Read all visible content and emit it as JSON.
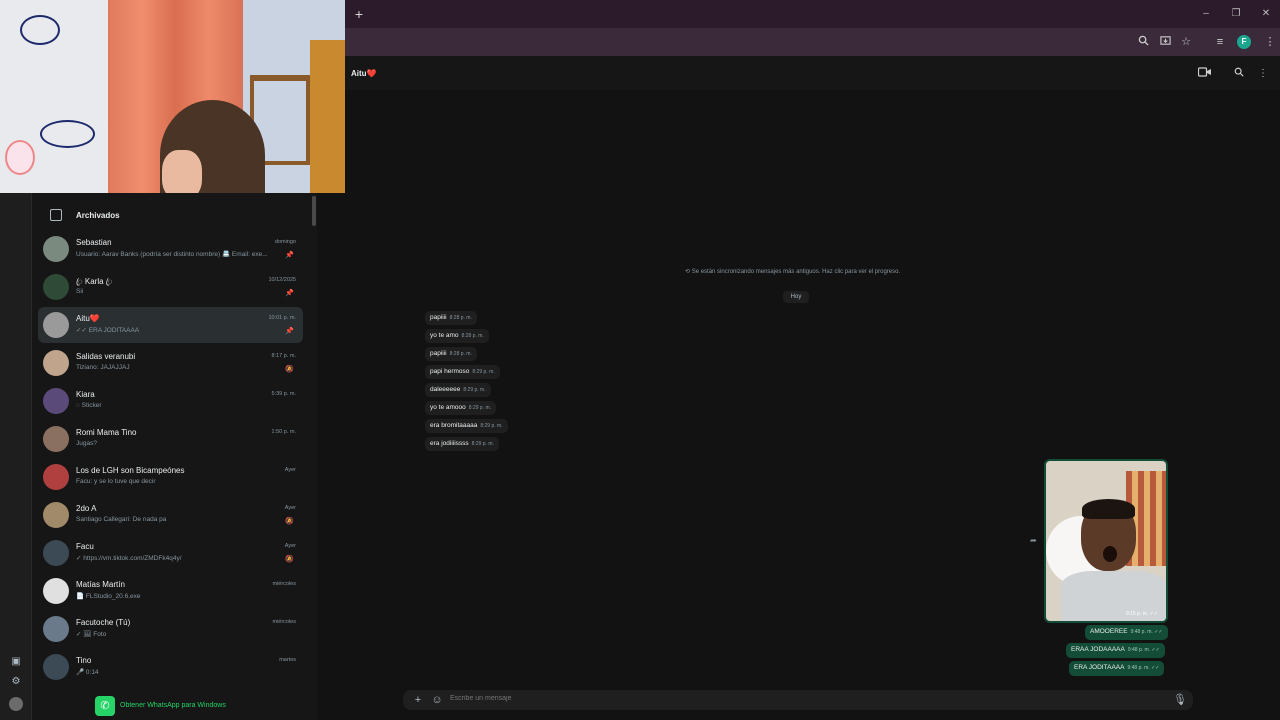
{
  "browser": {
    "new_tab_label": "+",
    "window_controls": [
      "–",
      "❐",
      "✕"
    ],
    "profile_initial": "F"
  },
  "sidebar": {
    "archived_label": "Archivados",
    "chats": [
      {
        "name": "Sebastian",
        "preview": "Usuario: Aarav Banks (podría ser distinto nombre) 📇 Email: exe...",
        "time": "domingo",
        "indicator": "📌"
      },
      {
        "name": "ꦿ Karla ꦿ",
        "preview": "Sii",
        "time": "10/12/2025",
        "indicator": "📌"
      },
      {
        "name": "Aitu❤️",
        "preview": "✓✓ ERA JODITAAAA",
        "time": "10:01 p. m.",
        "indicator": "📌"
      },
      {
        "name": "Salidas veranubi",
        "preview": "Tiziano: JAJAJJAJ",
        "time": "8:17 p. m.",
        "indicator": "🔕"
      },
      {
        "name": "Kiara",
        "preview": "◌ Sticker",
        "time": "5:39 p. m.",
        "indicator": ""
      },
      {
        "name": "Romi Mama Tino",
        "preview": "Jugas?",
        "time": "1:50 p. m.",
        "indicator": ""
      },
      {
        "name": "Los de LGH son Bicampeónes",
        "preview": "Facu: y se lo tuve que decir",
        "time": "Ayer",
        "indicator": ""
      },
      {
        "name": "2do A",
        "preview": "Santiago Callegari: De nada pa",
        "time": "Ayer",
        "indicator": "🔕"
      },
      {
        "name": "Facu",
        "preview": "✓ https://vm.tiktok.com/ZMDFk4q4y/",
        "time": "Ayer",
        "indicator": "🔕"
      },
      {
        "name": "Matías Martín",
        "preview": "📄 FLStudio_20.6.exe",
        "time": "miércoles",
        "indicator": ""
      },
      {
        "name": "Facutoche (Tú)",
        "preview": "✓ 🖼 Foto",
        "time": "miércoles",
        "indicator": ""
      },
      {
        "name": "Tino",
        "preview": "🎤 0:14",
        "time": "martes",
        "indicator": ""
      }
    ],
    "get_windows_label": "Obtener WhatsApp para Windows"
  },
  "chat": {
    "contact_name": "Aitu❤️",
    "sync_notice": "⟲ Se están sincronizando mensajes más antiguos. Haz clic para ver el progreso.",
    "day_label": "Hoy",
    "incoming": [
      {
        "text": "papiiii",
        "time": "8:28 p. m."
      },
      {
        "text": "yo te amo",
        "time": "8:28 p. m."
      },
      {
        "text": "papiiii",
        "time": "8:28 p. m."
      },
      {
        "text": "papi hermoso",
        "time": "8:29 p. m."
      },
      {
        "text": "daleeeeee",
        "time": "8:29 p. m."
      },
      {
        "text": "yo te amooo",
        "time": "8:29 p. m."
      },
      {
        "text": "era bromitaaaaa",
        "time": "8:29 p. m."
      },
      {
        "text": "era jodiiiissss",
        "time": "8:29 p. m."
      }
    ],
    "photo_time": "9:15 p. m. ✓✓",
    "outgoing": [
      {
        "text": "AMOOEREE",
        "time": "9:48 p. m. ✓✓"
      },
      {
        "text": "ERAA JODAAAAA",
        "time": "9:48 p. m. ✓✓"
      },
      {
        "text": "ERA JODITAAAA",
        "time": "9:48 p. m. ✓✓"
      }
    ],
    "composer_placeholder": "Escribe un mensaje"
  },
  "colors": {
    "accent": "#25d366",
    "outgoing_bubble": "#144d37",
    "incoming_bubble": "#1f1f1f"
  }
}
